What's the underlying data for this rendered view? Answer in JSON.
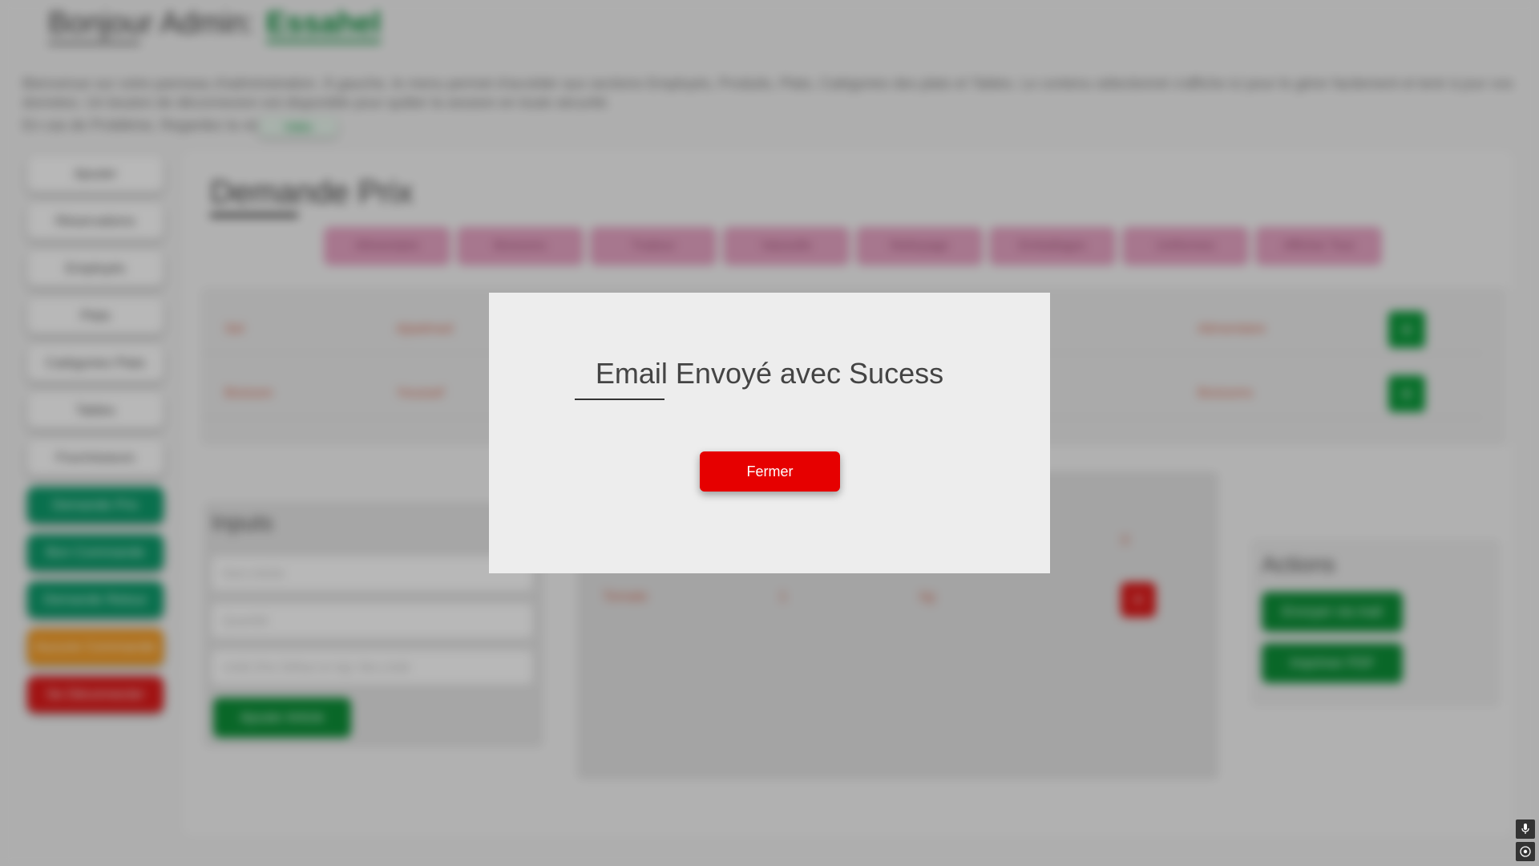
{
  "header": {
    "greeting": "Bonjour Admin:",
    "username": "Essahel",
    "intro_text": "Bienvenue sur votre panneau d'administration. À gauche, le menu permet d'accéder aux sections Employés, Produits, Plats, Catégories des plats et Tables. Le contenu sélectionné s'affiche ici pour le gérer facilement et tenir à jour vos données. Un bouton de déconnexion est disponible pour quitter la session en toute sécurité.",
    "video_prompt": "En cas de Problème, Regardez la vidéo",
    "video_button": "Vidéo"
  },
  "sidebar": {
    "items": [
      {
        "label": "Ajouter",
        "style": "white"
      },
      {
        "label": "Réservations",
        "style": "white"
      },
      {
        "label": "Employés",
        "style": "white"
      },
      {
        "label": "Plats",
        "style": "white"
      },
      {
        "label": "Catégories Plats",
        "style": "white"
      },
      {
        "label": "Tables",
        "style": "white"
      },
      {
        "label": "Fournisseurs",
        "style": "white"
      },
      {
        "label": "Demande Prix",
        "style": "green"
      },
      {
        "label": "Bon Commande",
        "style": "green"
      },
      {
        "label": "Demande Retour",
        "style": "green"
      },
      {
        "label": "Aucune Commande",
        "style": "orange"
      },
      {
        "label": "Se Déconnecter",
        "style": "red"
      }
    ]
  },
  "main": {
    "title": "Demande Prix",
    "category_tabs": [
      "Alimentaire",
      "Boissons",
      "Traiteur",
      "Vaisselle",
      "Nettoyage",
      "Emballages",
      "Uniformes",
      "Afficher Tout"
    ],
    "products": [
      {
        "name": "Sel",
        "supplier": "Ajiadmed",
        "category": "Alimentaire"
      },
      {
        "name": "Boisson",
        "supplier": "Youssef",
        "category": "Boissons"
      }
    ],
    "inputs": {
      "title": "Inputs",
      "field1_placeholder": "Nom Article",
      "field2_placeholder": "Quantité",
      "field3_placeholder": "Unité (Par Défaut en kg): litre,Unité",
      "add_button": "Ajouter Article"
    },
    "selected_items": {
      "header_marker": "X",
      "rows": [
        {
          "name": "Tomate",
          "quantity": "1",
          "unit": "kg"
        }
      ]
    },
    "actions": {
      "title": "Actions",
      "email_button": "Envoyer via mail",
      "print_button": "Imprimer PDF"
    }
  },
  "modal": {
    "message": "Email Envoyé avec Sucess",
    "close_button": "Fermer"
  },
  "colors": {
    "accent_green": "#0a8f3c",
    "danger_red": "#e60000",
    "modal_bg": "#ededed"
  },
  "corner_icons": [
    "microphone-icon",
    "accessibility-icon"
  ]
}
